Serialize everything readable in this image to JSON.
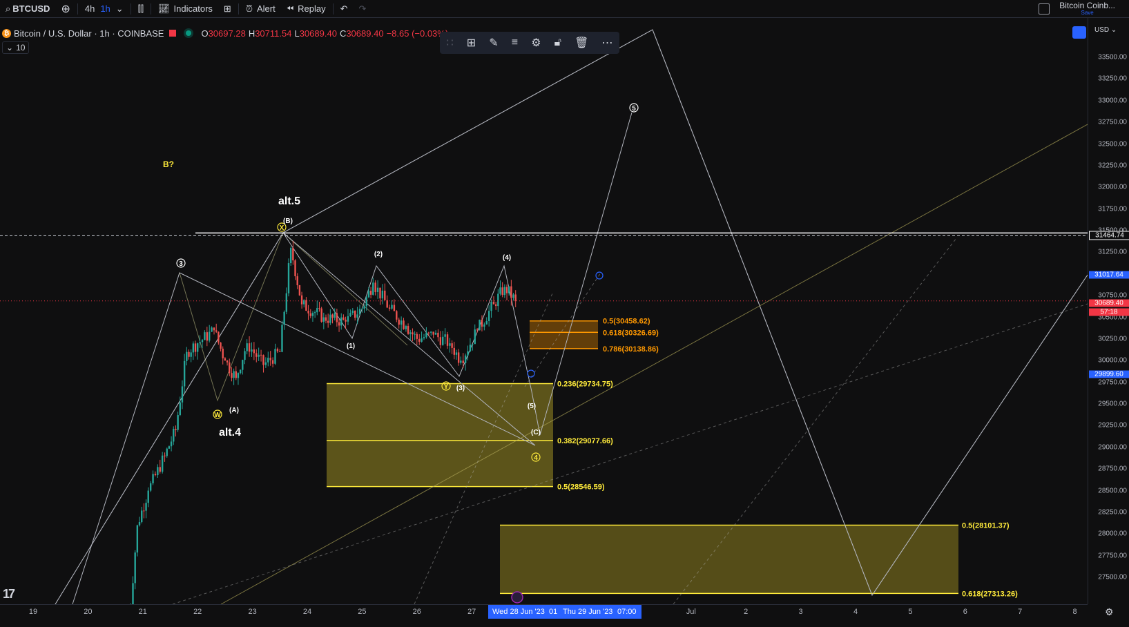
{
  "toolbar": {
    "symbol": "BTCUSD",
    "interval_4h": "4h",
    "interval_1h": "1h",
    "indicators": "Indicators",
    "alert": "Alert",
    "replay": "Replay",
    "layout_name": "Bitcoin Coinb...",
    "layout_save": "Save"
  },
  "legend": {
    "title": "Bitcoin / U.S. Dollar · 1h · COINBASE",
    "open_k": "O",
    "open_v": "30697.28",
    "high_k": "H",
    "high_v": "30711.54",
    "low_k": "L",
    "low_v": "30689.40",
    "close_k": "C",
    "close_v": "30689.40",
    "change": "−8.65 (−0.03%)",
    "indicator_count": "10"
  },
  "price_axis": {
    "currency": "USD",
    "ticks": [
      "33500.00",
      "33250.00",
      "33000.00",
      "32750.00",
      "32500.00",
      "32250.00",
      "32000.00",
      "31750.00",
      "31500.00",
      "31250.00",
      "31000.00",
      "30750.00",
      "30500.00",
      "30250.00",
      "30000.00",
      "29750.00",
      "29500.00",
      "29250.00",
      "29000.00",
      "28750.00",
      "28500.00",
      "28250.00",
      "28000.00",
      "27750.00",
      "27500.00"
    ],
    "badge_hline": "31464.74",
    "badge_blue": "31017.64",
    "badge_last": "30689.40",
    "badge_countdown": "57:18",
    "badge_low": "29899.60"
  },
  "time_axis": {
    "ticks": [
      "19",
      "20",
      "21",
      "22",
      "23",
      "24",
      "25",
      "26",
      "27",
      "Jul",
      "2",
      "3",
      "4",
      "5",
      "6",
      "7",
      "8"
    ],
    "selection_start": "Wed 28 Jun '23",
    "selection_mid": "01",
    "selection_end": "Thu 29 Jun '23",
    "selection_time": "07:00"
  },
  "colors": {
    "up": "#26a69a",
    "down": "#ef5350",
    "fib_yellow": "#ffeb3b",
    "fib_orange": "#ff9800",
    "accent": "#2962ff",
    "background": "#0f0f10"
  },
  "annotations": {
    "b_q": "B?",
    "alt5": "alt.5",
    "alt4": "alt.4",
    "w3": "3",
    "w5": "5",
    "w4": "4",
    "B": "(B)",
    "X": "X",
    "W": "W",
    "Y": "Y",
    "A": "(A)",
    "p1": "(1)",
    "p2": "(2)",
    "p3": "(3)",
    "p4": "(4)",
    "p5": "(5)",
    "C": "(C)"
  },
  "chart_data": {
    "type": "candlestick",
    "symbol": "BTCUSD",
    "interval": "1h",
    "y_range": [
      27350,
      33700
    ],
    "x_range": [
      "2023-06-19",
      "2023-07-08"
    ],
    "last_price": 30689.4,
    "horizontal_line": 31464.74,
    "fib_levels": [
      {
        "label": "0.5(30458.62)",
        "value": 30458.62,
        "color": "orange"
      },
      {
        "label": "0.618(30326.69)",
        "value": 30326.69,
        "color": "orange"
      },
      {
        "label": "0.786(30138.86)",
        "value": 30138.86,
        "color": "orange"
      },
      {
        "label": "0.236(29734.75)",
        "value": 29734.75,
        "color": "yellow"
      },
      {
        "label": "0.382(29077.66)",
        "value": 29077.66,
        "color": "yellow"
      },
      {
        "label": "0.5(28546.59)",
        "value": 28546.59,
        "color": "yellow"
      },
      {
        "label": "0.5(28101.37)",
        "value": 28101.37,
        "color": "yellow"
      },
      {
        "label": "0.618(27313.26)",
        "value": 27313.26,
        "color": "yellow"
      }
    ],
    "price_path_approx": [
      {
        "t": 20.7,
        "close": 26600
      },
      {
        "t": 20.9,
        "close": 28100
      },
      {
        "t": 21.1,
        "close": 28500
      },
      {
        "t": 21.4,
        "close": 28900
      },
      {
        "t": 21.6,
        "close": 29200
      },
      {
        "t": 21.8,
        "close": 30100
      },
      {
        "t": 22.0,
        "close": 30200
      },
      {
        "t": 22.3,
        "close": 30350
      },
      {
        "t": 22.5,
        "close": 30000
      },
      {
        "t": 22.7,
        "close": 29800
      },
      {
        "t": 22.9,
        "close": 30200
      },
      {
        "t": 23.2,
        "close": 29950
      },
      {
        "t": 23.5,
        "close": 30100
      },
      {
        "t": 23.7,
        "close": 31300
      },
      {
        "t": 23.9,
        "close": 30650
      },
      {
        "t": 24.3,
        "close": 30500
      },
      {
        "t": 24.7,
        "close": 30450
      },
      {
        "t": 25.0,
        "close": 30600
      },
      {
        "t": 25.2,
        "close": 30900
      },
      {
        "t": 25.5,
        "close": 30600
      },
      {
        "t": 25.8,
        "close": 30400
      },
      {
        "t": 26.0,
        "close": 30250
      },
      {
        "t": 26.3,
        "close": 30300
      },
      {
        "t": 26.6,
        "close": 30200
      },
      {
        "t": 26.8,
        "close": 30000
      },
      {
        "t": 27.1,
        "close": 30350
      },
      {
        "t": 27.4,
        "close": 30650
      },
      {
        "t": 27.6,
        "close": 30850
      },
      {
        "t": 27.8,
        "close": 30689.4
      }
    ]
  }
}
